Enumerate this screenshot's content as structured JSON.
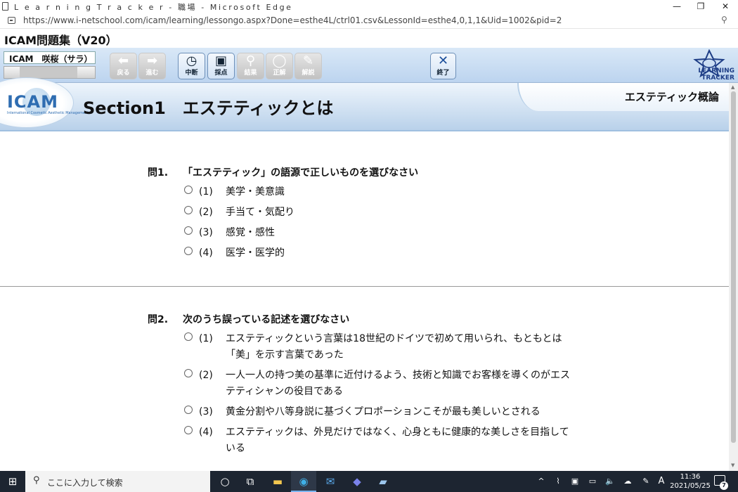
{
  "browser": {
    "title": "L e a r n i n g T r a c k e r - 職場 - Microsoft Edge",
    "url": "https://www.i-netschool.com/icam/learning/lessongo.aspx?Done=esthe4L/ctrl01.csv&LessonId=esthe4,0,1,1&Uid=1002&pid=2",
    "minimize": "—",
    "restore": "❐",
    "close": "✕"
  },
  "app": {
    "title": "ICAM問題集（V20）",
    "user": "ICAM　咲桜（サラ）",
    "logo_text": "LEARNING\nTRACKER"
  },
  "toolbar": {
    "buttons": [
      {
        "label": "戻る",
        "glyph": "⬅",
        "enabled": false
      },
      {
        "label": "進む",
        "glyph": "➡",
        "enabled": false
      },
      {
        "label": "中断",
        "glyph": "◷",
        "enabled": true
      },
      {
        "label": "採点",
        "glyph": "▣",
        "enabled": true
      },
      {
        "label": "結果",
        "glyph": "⚲",
        "enabled": false
      },
      {
        "label": "正解",
        "glyph": "◯",
        "enabled": false
      },
      {
        "label": "解説",
        "glyph": "✎",
        "enabled": false
      }
    ],
    "exit_label": "終了",
    "exit_glyph": "✕"
  },
  "section": {
    "logo": "ICAM",
    "logo_sub": "International Cosmetic Aesthetic Management",
    "title": "Section1　エステティックとは",
    "category": "エステティック概論"
  },
  "questions": [
    {
      "number": "問1.",
      "text": "「エステティック」の語源で正しいものを選びなさい",
      "options": [
        {
          "no": "(1)",
          "text": "美学・美意識"
        },
        {
          "no": "(2)",
          "text": "手当て・気配り"
        },
        {
          "no": "(3)",
          "text": "感覚・感性"
        },
        {
          "no": "(4)",
          "text": "医学・医学的"
        }
      ]
    },
    {
      "number": "問2.",
      "text": "次のうち誤っている記述を選びなさい",
      "options": [
        {
          "no": "(1)",
          "text": "エステティックという言葉は18世紀のドイツで初めて用いられ、もともとは「美」を示す言葉であった"
        },
        {
          "no": "(2)",
          "text": "一人一人の持つ美の基準に近付けるよう、技術と知識でお客様を導くのがエステティシャンの役目である"
        },
        {
          "no": "(3)",
          "text": "黄金分割や八等身説に基づくプロポーションこそが最も美しいとされる"
        },
        {
          "no": "(4)",
          "text": "エステティックは、外見だけではなく、心身ともに健康的な美しさを目指している"
        }
      ]
    }
  ],
  "taskbar": {
    "search_placeholder": "ここに入力して検索",
    "time": "11:36",
    "date": "2021/05/25",
    "ime": "A",
    "notification_count": "7"
  }
}
